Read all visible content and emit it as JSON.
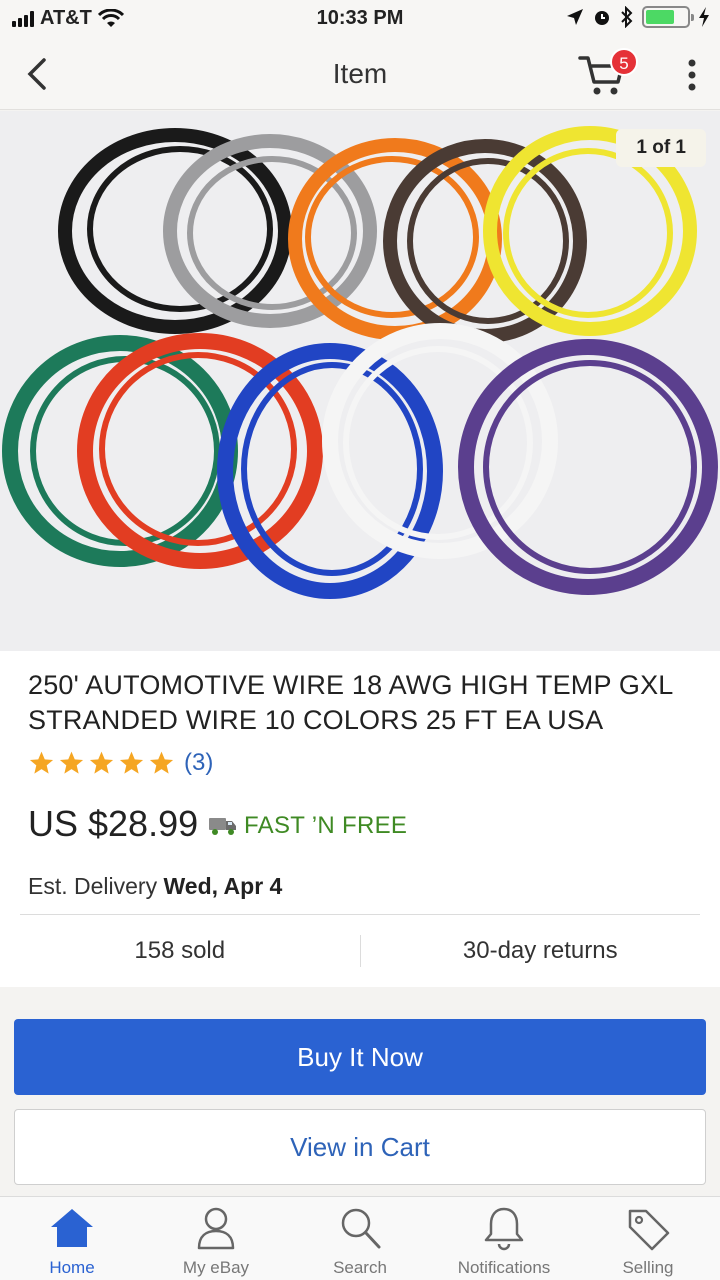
{
  "status_bar": {
    "carrier": "AT&T",
    "time": "10:33 PM"
  },
  "nav": {
    "title": "Item",
    "cart_count": "5"
  },
  "gallery": {
    "counter": "1 of 1"
  },
  "product": {
    "title": "250' AUTOMOTIVE WIRE 18 AWG HIGH TEMP GXL STRANDED WIRE 10 COLORS 25 FT EA  USA",
    "rating": 5,
    "rating_max": 5,
    "review_count": "(3)",
    "price": "US $28.99",
    "shipping": "FAST ’N FREE",
    "delivery_prefix": "Est. Delivery",
    "delivery_date": "Wed, Apr 4",
    "sold": "158 sold",
    "returns": "30-day returns"
  },
  "actions": {
    "buy_now": "Buy It Now",
    "view_cart": "View in Cart"
  },
  "tabs": [
    {
      "label": "Home",
      "icon": "home-icon",
      "active": true
    },
    {
      "label": "My eBay",
      "icon": "person-icon",
      "active": false
    },
    {
      "label": "Search",
      "icon": "search-icon",
      "active": false
    },
    {
      "label": "Notifications",
      "icon": "bell-icon",
      "active": false
    },
    {
      "label": "Selling",
      "icon": "tag-icon",
      "active": false
    }
  ],
  "colors": {
    "accent": "#2a62d2",
    "link": "#2e63b8",
    "shipping_green": "#3f8a24",
    "badge_red": "#e53238",
    "star": "#f5a623"
  }
}
